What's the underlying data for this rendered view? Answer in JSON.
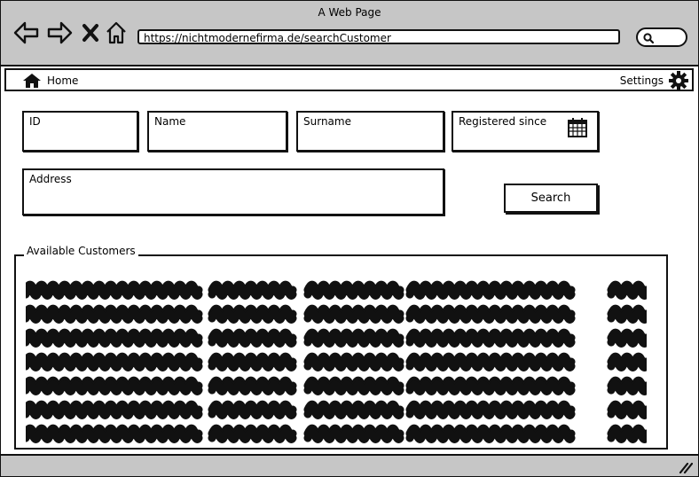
{
  "window": {
    "title": "A Web Page"
  },
  "browser": {
    "url": "https://nichtmodernefirma.de/searchCustomer",
    "buttons": [
      "back-arrow-icon",
      "forward-arrow-icon",
      "close-x-icon",
      "home-outline-icon"
    ],
    "search_icon": "magnifier-icon"
  },
  "menubar": {
    "home_label": "Home",
    "home_icon": "house-icon",
    "settings_label": "Settings",
    "settings_icon": "gear-icon"
  },
  "form": {
    "id_label": "ID",
    "name_label": "Name",
    "surname_label": "Surname",
    "registered_label": "Registered since",
    "registered_icon": "calendar-icon",
    "address_label": "Address",
    "search_button": "Search"
  },
  "results": {
    "title": "Available Customers",
    "columns": 5,
    "rows": 7,
    "content": "scribbled-placeholder-text"
  },
  "colors": {
    "chrome": "#c6c6c6",
    "ink": "#111111",
    "background": "#ffffff"
  }
}
